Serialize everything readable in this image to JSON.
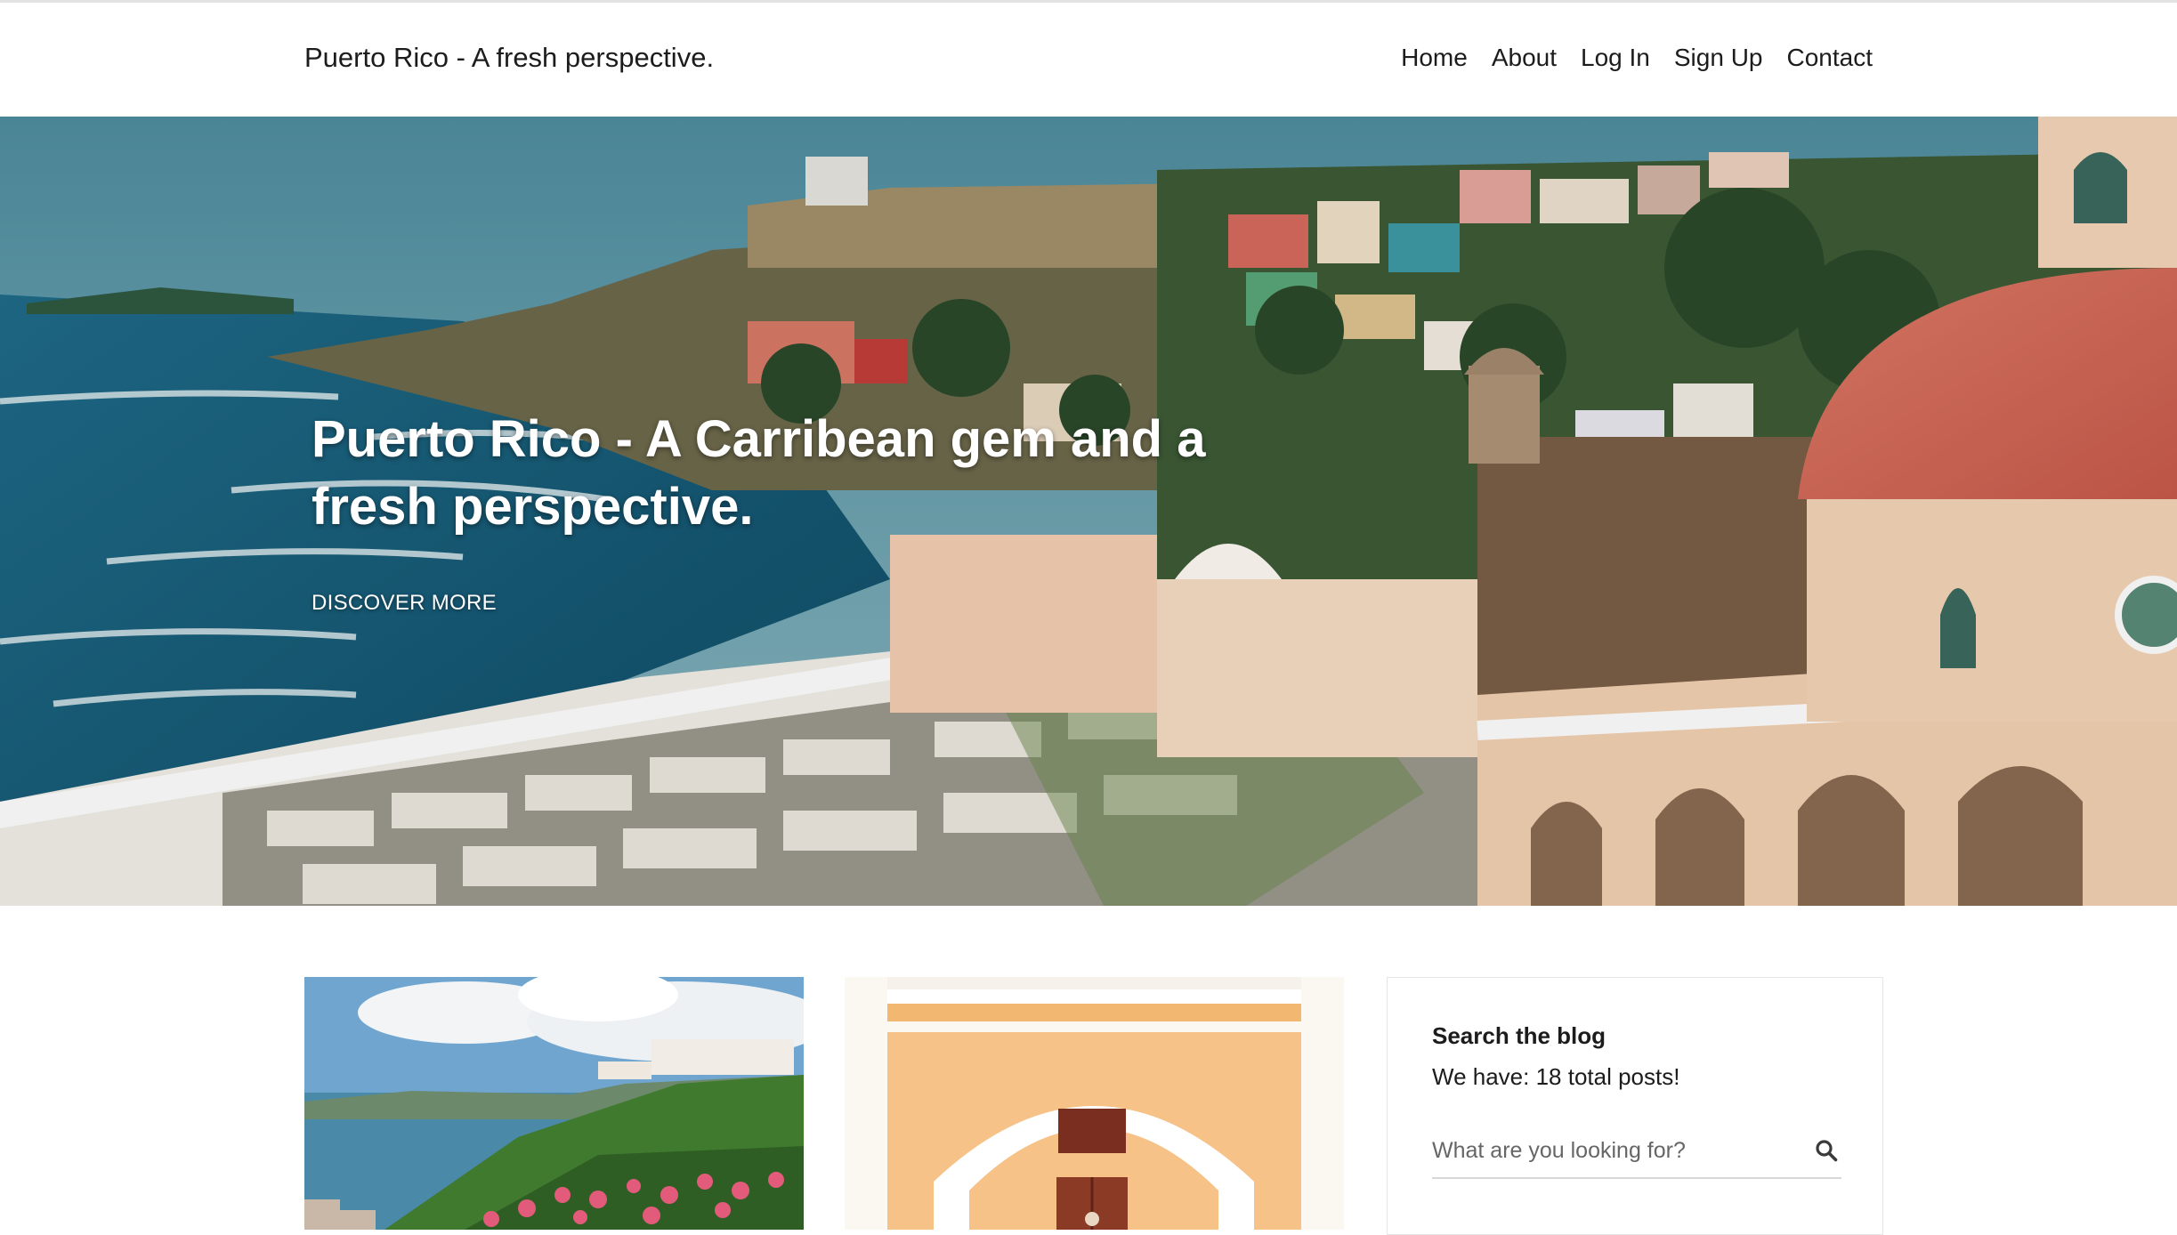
{
  "header": {
    "brand": "Puerto Rico - A fresh perspective.",
    "nav": [
      "Home",
      "About",
      "Log In",
      "Sign Up",
      "Contact"
    ]
  },
  "hero": {
    "title": "Puerto Rico - A Carribean gem and a fresh perspective.",
    "cta": "DISCOVER MORE"
  },
  "sidebar": {
    "search_title": "Search the blog",
    "post_count_text": "We have: 18 total posts!",
    "search_placeholder": "What are you looking for?",
    "search_icon": "search-icon"
  },
  "colors": {
    "text": "#1c1c1c",
    "dome": "#d9705f",
    "sea": "#1d5f7c",
    "building": "#f2c9a6"
  }
}
